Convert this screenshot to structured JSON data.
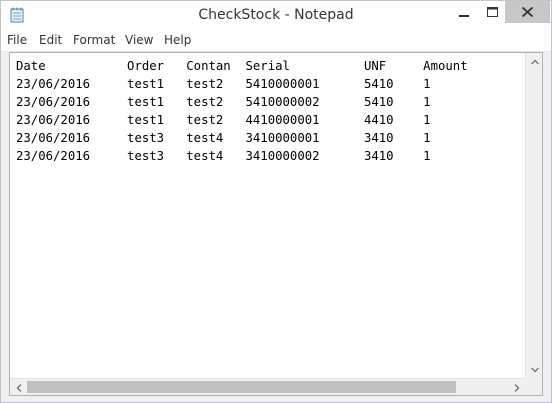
{
  "window": {
    "title": "CheckStock - Notepad"
  },
  "menu": {
    "file": "File",
    "edit": "Edit",
    "format": "Format",
    "view": "View",
    "help": "Help"
  },
  "editor": {
    "content": "Date           Order   Contan  Serial          UNF     Amount\n23/06/2016     test1   test2   5410000001      5410    1\n23/06/2016     test1   test2   5410000002      5410    1\n23/06/2016     test1   test2   4410000001      4410    1\n23/06/2016     test3   test4   3410000001      3410    1\n23/06/2016     test3   test4   3410000002      3410    1"
  },
  "icons": {
    "app": "notepad-icon",
    "minimize": "minimize-icon",
    "maximize": "maximize-icon",
    "close": "close-icon",
    "scroll_up": "chevron-up-icon",
    "scroll_down": "chevron-down-icon",
    "scroll_left": "chevron-left-icon",
    "scroll_right": "chevron-right-icon"
  },
  "colors": {
    "close_button": "#c7c7c7",
    "scroll_thumb": "#c1c1c1",
    "frame": "#f0f0f0"
  }
}
